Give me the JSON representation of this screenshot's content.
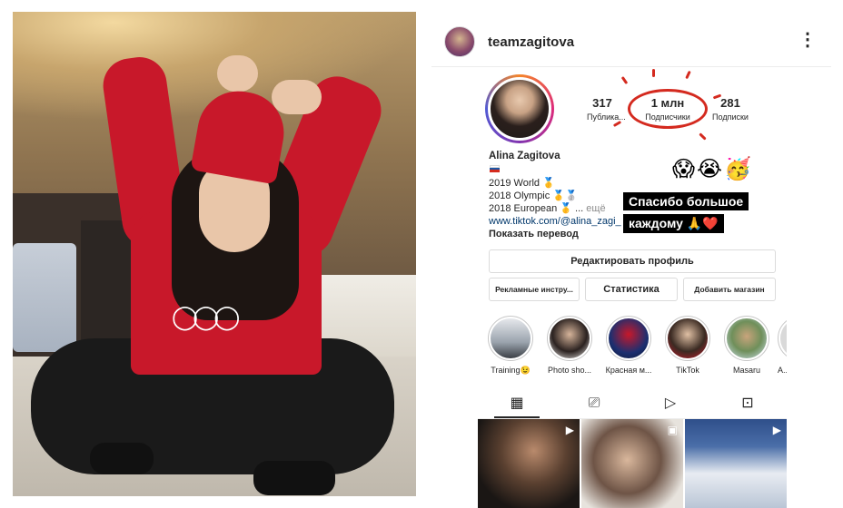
{
  "header": {
    "username": "teamzagitova",
    "more_icon": "⋮"
  },
  "profile": {
    "stats": [
      {
        "num": "317",
        "label": "Публика..."
      },
      {
        "num": "1 млн",
        "label": "Подписчики"
      },
      {
        "num": "281",
        "label": "Подписки"
      }
    ],
    "name": "Alina Zagitova",
    "bio_lines": [
      "2019 World 🥇",
      "2018 Olympic 🥇🥈",
      "2018 European 🥇 ..."
    ],
    "more_label": "ещё",
    "link": "www.tiktok.com/@alina_zagi_",
    "translate": "Показать перевод",
    "emojis": "😱😭🥳",
    "sticker_line1": "Спасибо большое",
    "sticker_line2": "каждому 🙏❤️"
  },
  "buttons": {
    "edit_profile": "Редактировать профиль",
    "ad_tools": "Рекламные инстру...",
    "statistics": "Статистика",
    "add_shop": "Добавить магазин"
  },
  "highlights": [
    {
      "label": "Training😉"
    },
    {
      "label": "Photo sho..."
    },
    {
      "label": "Красная м..."
    },
    {
      "label": "TikTok"
    },
    {
      "label": "Masaru"
    },
    {
      "label": "A..."
    }
  ],
  "tabs": [
    "grid-icon",
    "igtv-icon",
    "reels-icon",
    "tagged-icon"
  ],
  "photo": {
    "rings_glyph": "◯◯◯"
  },
  "colors": {
    "accent_red": "#d42a1f",
    "sweater_red": "#c8182a",
    "link_blue": "#00376b"
  }
}
